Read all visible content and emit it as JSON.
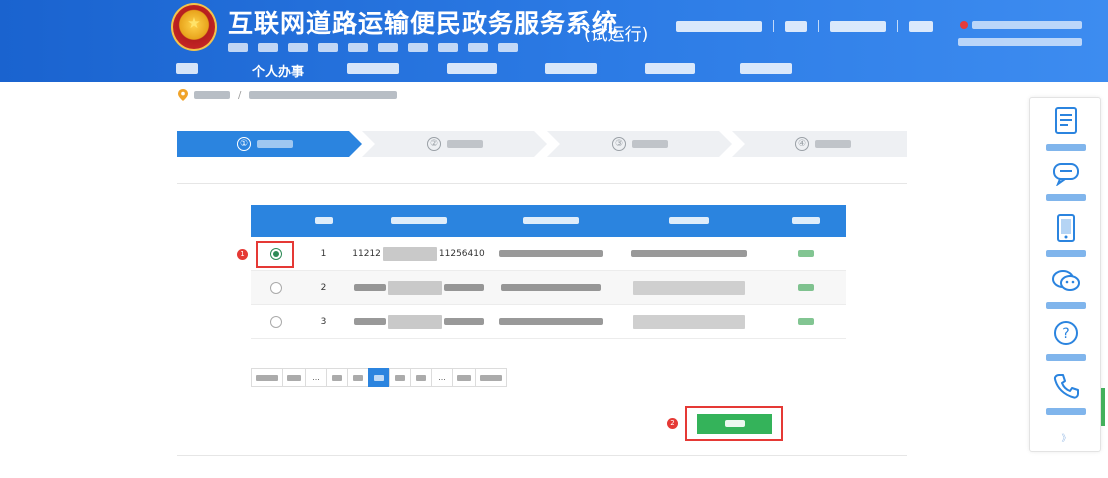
{
  "header": {
    "title": "互联网道路运输便民政务服务系统",
    "subtitle": "",
    "trial_label": "(试运行)",
    "top_links": [
      "",
      "",
      "",
      ""
    ],
    "emblem_icon": "national-emblem-icon"
  },
  "nav": {
    "items": [
      {
        "label": ""
      },
      {
        "label": "个人办事"
      },
      {
        "label": ""
      },
      {
        "label": ""
      },
      {
        "label": ""
      },
      {
        "label": ""
      },
      {
        "label": ""
      }
    ],
    "active_index": 1
  },
  "breadcrumb": {
    "items": [
      "",
      ""
    ],
    "separator": "/"
  },
  "steps": [
    {
      "number": "①",
      "label": ""
    },
    {
      "number": "②",
      "label": ""
    },
    {
      "number": "③",
      "label": ""
    },
    {
      "number": "④",
      "label": ""
    }
  ],
  "steps_active_index": 0,
  "table": {
    "columns": [
      "",
      "",
      "",
      "",
      "",
      ""
    ],
    "rows": [
      {
        "selected": true,
        "index": "1",
        "id_prefix": "11212",
        "id_suffix": "11256410",
        "type": "",
        "name": "",
        "status": ""
      },
      {
        "selected": false,
        "index": "2",
        "id_prefix": "",
        "id_suffix": "",
        "type": "",
        "name": "",
        "status": ""
      },
      {
        "selected": false,
        "index": "3",
        "id_prefix": "",
        "id_suffix": "",
        "type": "",
        "name": "",
        "status": ""
      }
    ]
  },
  "pagination": {
    "items": [
      "",
      "",
      "...",
      "",
      "",
      "",
      "",
      "",
      "...",
      "",
      ""
    ],
    "active_index": 5
  },
  "actions": {
    "next_label": ""
  },
  "markers": {
    "select": "1",
    "next": "2"
  },
  "sidebar": {
    "items": [
      {
        "icon": "document-icon",
        "label": ""
      },
      {
        "icon": "chat-bubble-icon",
        "label": ""
      },
      {
        "icon": "mobile-phone-icon",
        "label": ""
      },
      {
        "icon": "wechat-icon",
        "label": ""
      },
      {
        "icon": "question-circle-icon",
        "label": ""
      },
      {
        "icon": "phone-call-icon",
        "label": ""
      }
    ],
    "more_label": "》"
  },
  "colors": {
    "header_blue": "#1a63cf",
    "active_blue": "#2b84df",
    "table_header": "#2b84df",
    "next_button": "#34b35a",
    "status_green": "#2e9f4a",
    "annotation_red": "#e53935"
  }
}
